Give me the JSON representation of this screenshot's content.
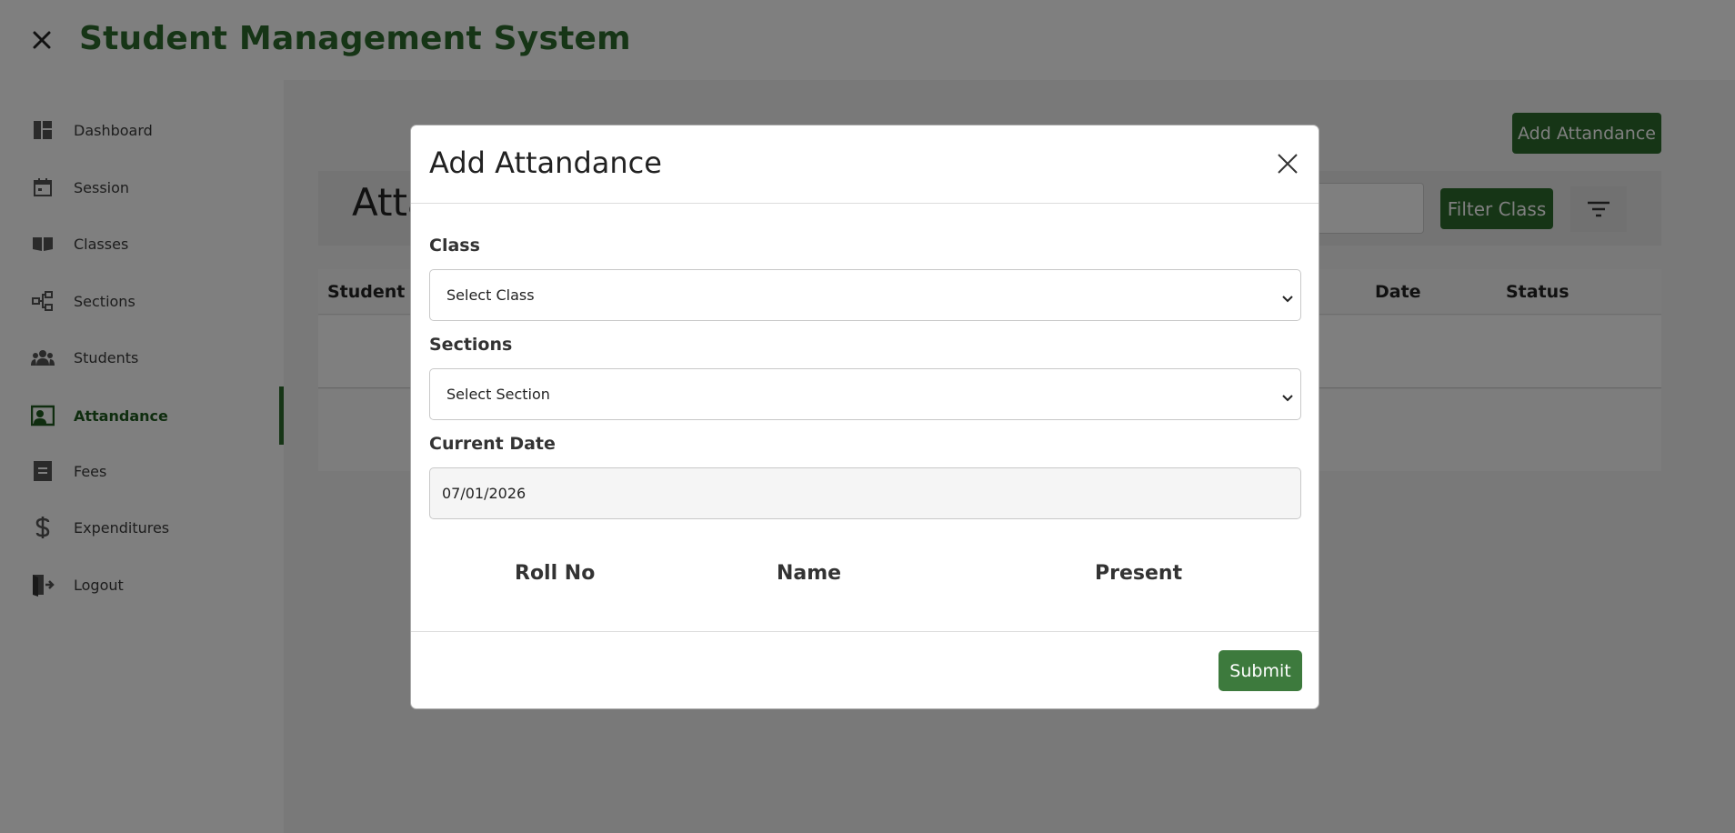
{
  "header": {
    "title": "Student Management System",
    "menu_icon": "close-icon"
  },
  "sidebar": {
    "items": [
      {
        "label": "Dashboard",
        "icon": "dashboard-icon"
      },
      {
        "label": "Session",
        "icon": "calendar-icon"
      },
      {
        "label": "Classes",
        "icon": "book-icon"
      },
      {
        "label": "Sections",
        "icon": "hierarchy-icon"
      },
      {
        "label": "Students",
        "icon": "people-icon"
      },
      {
        "label": "Attandance",
        "icon": "person-board-icon",
        "active": true
      },
      {
        "label": "Fees",
        "icon": "document-icon"
      },
      {
        "label": "Expenditures",
        "icon": "dollar-icon"
      },
      {
        "label": "Logout",
        "icon": "logout-icon"
      }
    ]
  },
  "main": {
    "add_button": "Add Attandance",
    "heading": "Atta",
    "filter_button": "Filter Class",
    "table_headers": [
      "Student Na",
      "Date",
      "Status"
    ]
  },
  "modal": {
    "title": "Add Attandance",
    "class_label": "Class",
    "class_value": "Select Class",
    "sections_label": "Sections",
    "sections_value": "Select Section",
    "date_label": "Current Date",
    "date_value": "07/01/2026",
    "columns": [
      "Roll No",
      "Name",
      "Present"
    ],
    "submit_label": "Submit"
  },
  "colors": {
    "brand": "#2d6a2d",
    "overlay": "rgba(0,0,0,0.5)"
  }
}
